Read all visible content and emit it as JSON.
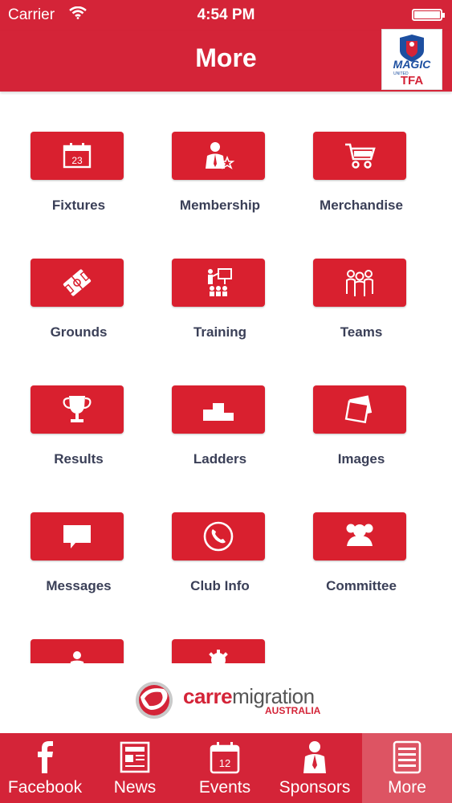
{
  "status": {
    "carrier": "Carrier",
    "time": "4:54 PM"
  },
  "navbar": {
    "title": "More",
    "logo_line1": "MAGIC",
    "logo_line2": "TFA",
    "logo_small": "UNITED"
  },
  "grid": [
    {
      "label": "Fixtures",
      "icon": "calendar-icon",
      "calendar_day": "23"
    },
    {
      "label": "Membership",
      "icon": "member-icon"
    },
    {
      "label": "Merchandise",
      "icon": "cart-icon"
    },
    {
      "label": "Grounds",
      "icon": "field-icon"
    },
    {
      "label": "Training",
      "icon": "training-icon"
    },
    {
      "label": "Teams",
      "icon": "team-icon"
    },
    {
      "label": "Results",
      "icon": "trophy-icon"
    },
    {
      "label": "Ladders",
      "icon": "podium-icon"
    },
    {
      "label": "Images",
      "icon": "images-icon"
    },
    {
      "label": "Messages",
      "icon": "message-icon"
    },
    {
      "label": "Club Info",
      "icon": "phone-icon"
    },
    {
      "label": "Committee",
      "icon": "committee-icon"
    },
    {
      "label": "",
      "icon": "person-icon"
    },
    {
      "label": "",
      "icon": "gear-icon"
    }
  ],
  "footer": {
    "brand_part1": "carre",
    "brand_part2": "migration",
    "brand_sub": "AUSTRALIA"
  },
  "tabs": [
    {
      "label": "Facebook",
      "icon": "facebook-icon"
    },
    {
      "label": "News",
      "icon": "news-icon"
    },
    {
      "label": "Events",
      "icon": "events-icon",
      "day": "12"
    },
    {
      "label": "Sponsors",
      "icon": "sponsors-icon"
    },
    {
      "label": "More",
      "icon": "more-icon",
      "active": true
    }
  ],
  "colors": {
    "brand_red": "#d42438",
    "tile_red": "#d9202f",
    "label_text": "#3a3f57"
  }
}
